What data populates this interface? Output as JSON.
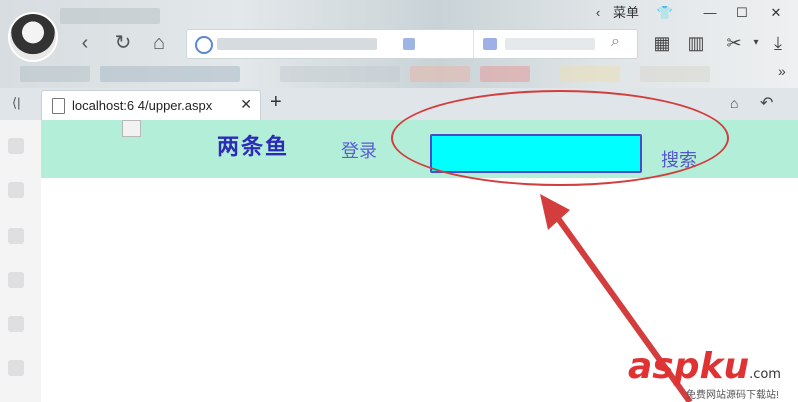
{
  "browser": {
    "titlebar": {
      "menu_label": "菜单"
    },
    "tab": {
      "title": "localhost:6⁠  ⁠4/upper.aspx",
      "close": "✕"
    },
    "new_tab": "+",
    "icons": {
      "back": "chevron-left-icon",
      "refresh": "refresh-icon",
      "home": "home-icon",
      "apps": "apps-grid-icon",
      "reader": "book-icon",
      "cut": "scissors-icon",
      "download": "download-icon"
    }
  },
  "page": {
    "title": "两条鱼",
    "login_label": "登录",
    "search_value": "",
    "search_label": "搜索",
    "header_bg": "#b3efd8",
    "search_bg": "#00ffff"
  },
  "annotation": {
    "color": "#d33d3d"
  },
  "watermark": {
    "asp": "asp",
    "ku": "ku",
    "com": ".com",
    "sub": "免费网站源码下载站!"
  }
}
